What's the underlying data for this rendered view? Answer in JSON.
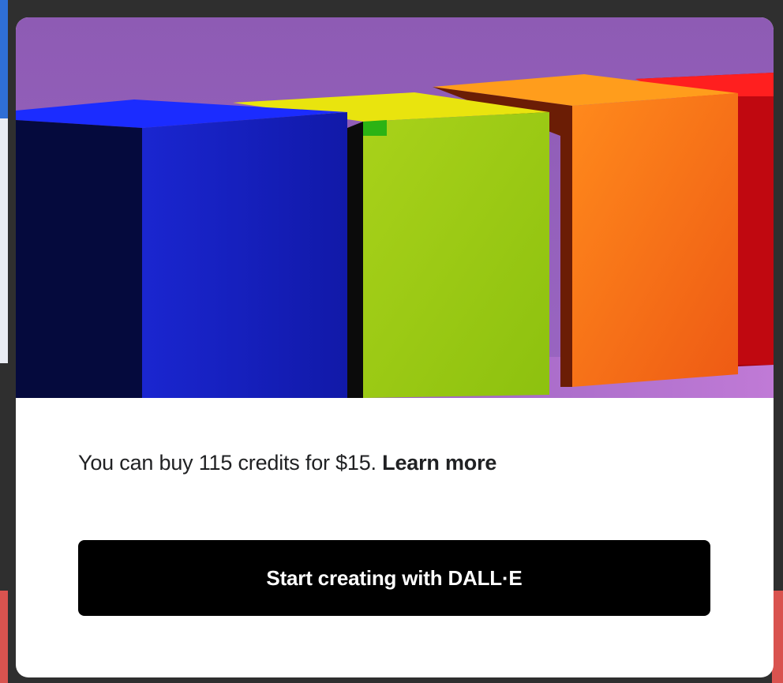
{
  "modal": {
    "hero_image": "colored-blocks-illustration",
    "message": "You can buy 115 credits for $15.",
    "learn_more_label": "Learn more",
    "cta_label": "Start creating with DALL·E"
  },
  "colors": {
    "cta_background": "#000000",
    "cta_text": "#ffffff",
    "hero_background": "#8e5bb4",
    "block_blue": "#1a1fbf",
    "block_green": "#9fcb12",
    "block_orange": "#f57a12",
    "block_red": "#e5121a"
  }
}
